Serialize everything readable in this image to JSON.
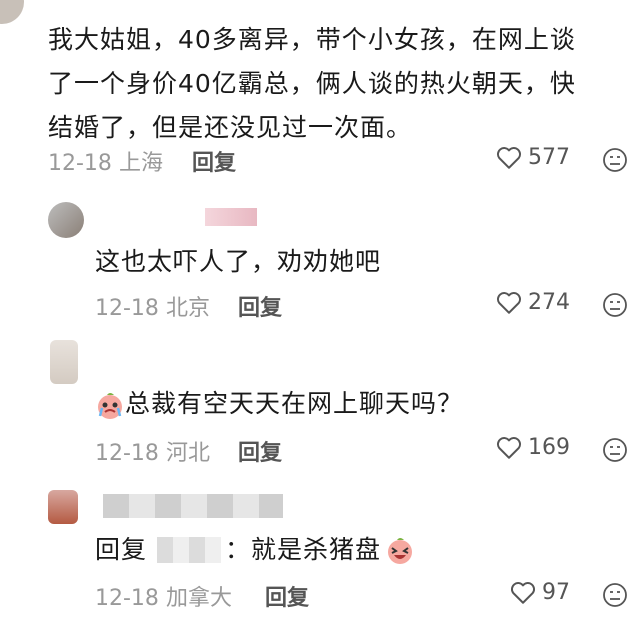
{
  "comments": [
    {
      "text": "我大姑姐，40多离异，带个小女孩，在网上谈了一个身价40亿霸总，俩人谈的热火朝天，快结婚了，但是还没见过一次面。",
      "lines": [
        "我大姑姐，40多离异，带个小女孩，在网上谈",
        "了一个身价40亿霸总，俩人谈的热火朝天，快",
        "结婚了，但是还没见过一次面。"
      ],
      "date": "12-18",
      "location": "上海",
      "reply_label": "回复",
      "likes": "577"
    },
    {
      "text": "这也太吓人了，劝劝她吧",
      "date": "12-18",
      "location": "北京",
      "reply_label": "回复",
      "likes": "274"
    },
    {
      "text": "总裁有空天天在网上聊天吗？",
      "date": "12-18",
      "location": "河北",
      "reply_label": "回复",
      "likes": "169"
    },
    {
      "reply_prefix": "回复",
      "text": "：就是杀猪盘",
      "date": "12-18",
      "location": "加拿大",
      "reply_label": "回复",
      "likes": "97"
    }
  ],
  "colors": {
    "meta": "#999999",
    "text": "#1a1a1a",
    "icon": "#555555"
  },
  "icons": {
    "like": "heart-outline-icon",
    "dislike": "sad-face-icon",
    "emoji": "crying-peach-emoji"
  }
}
